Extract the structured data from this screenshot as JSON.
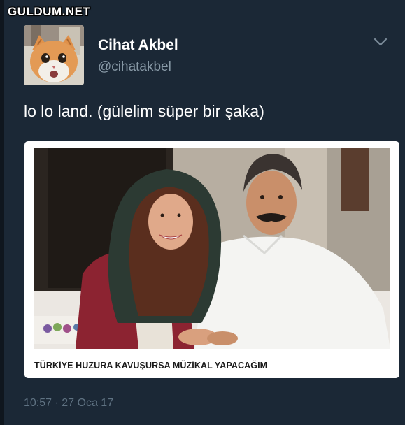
{
  "watermark": "GULDUM.NET",
  "tweet": {
    "display_name": "Cihat Akbel",
    "handle": "@cihatakbel",
    "text": "lo lo land. (gülelim süper bir şaka)",
    "timestamp": "10:57 · 27 Oca 17"
  },
  "card": {
    "caption": "TÜRKİYE HUZURA KAVUŞURSA MÜZİKAL YAPACAĞIM"
  },
  "icons": {
    "menu": "chevron-down-icon"
  },
  "colors": {
    "background": "#1b2836",
    "text_primary": "#ffffff",
    "text_secondary": "#8899a6"
  }
}
